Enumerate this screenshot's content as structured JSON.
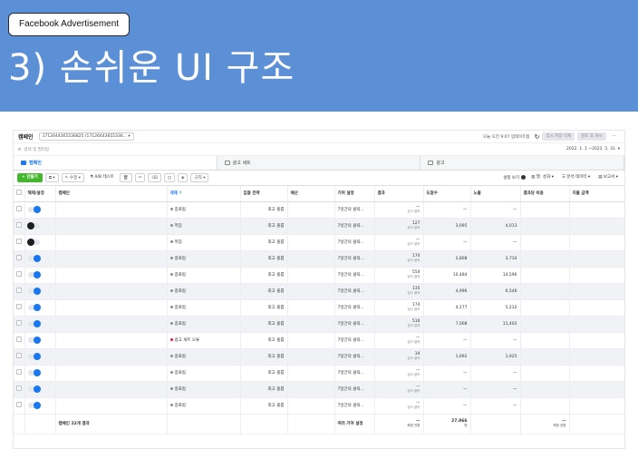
{
  "banner": {
    "tag": "Facebook Advertisement",
    "headline": "3) 손쉬운 UI 구조"
  },
  "header": {
    "title": "캠페인",
    "account": "1712644365536825 (17126443655336...",
    "updated": "오늘 오전 9:07 업데이트됨",
    "discard": "임시 저장 삭제",
    "review": "검토 후 게시",
    "more": "···"
  },
  "search": {
    "placeholder": "검색 및 필터링",
    "date_range": "2022. 1. 1.~2022. 5. 31."
  },
  "tabs": [
    "캠페인",
    "광고 세트",
    "광고"
  ],
  "toolbar": {
    "create": "+ 만들기",
    "edit": "수정",
    "ab_test": "A/B 테스트",
    "rules": "규칙",
    "setting_view": "설정 보기",
    "columns": "열: 성과",
    "breakdown": "분석 데이터",
    "reports": "보고서"
  },
  "columns": [
    "",
    "해제/설정",
    "캠페인",
    "게재 ↑",
    "입찰 전략",
    "예산",
    "기여 설정",
    "결과",
    "도달수",
    "노출",
    "결과당 비용",
    "지출 금액"
  ],
  "rows": [
    {
      "on": true,
      "status": "종료됨",
      "err": false,
      "bid": "최고 볼륨",
      "attr": "7일간의 클릭...",
      "result": "—",
      "result_sub": "링크 클릭",
      "reach": "—",
      "impr": "—"
    },
    {
      "on": false,
      "status": "꺼짐",
      "err": false,
      "bid": "최고 볼륨",
      "attr": "7일간의 클릭...",
      "result": "127",
      "result_sub": "링크 클릭",
      "reach": "3,095",
      "impr": "4,013"
    },
    {
      "on": false,
      "status": "꺼짐",
      "err": false,
      "bid": "최고 볼륨",
      "attr": "7일간의 클릭...",
      "result": "—",
      "result_sub": "링크 클릭",
      "reach": "—",
      "impr": "—"
    },
    {
      "on": true,
      "status": "종료됨",
      "err": false,
      "bid": "최고 볼륨",
      "attr": "7일간의 클릭...",
      "result": "174",
      "result_sub": "링크 클릭",
      "reach": "2,808",
      "impr": "3,734"
    },
    {
      "on": true,
      "status": "종료됨",
      "err": false,
      "bid": "최고 볼륨",
      "attr": "7일간의 클릭...",
      "result": "554",
      "result_sub": "링크 클릭",
      "reach": "10,484",
      "impr": "14,596"
    },
    {
      "on": true,
      "status": "종료됨",
      "err": false,
      "bid": "최고 볼륨",
      "attr": "7일간의 클릭...",
      "result": "135",
      "result_sub": "링크 클릭",
      "reach": "4,996",
      "impr": "6,546"
    },
    {
      "on": true,
      "status": "종료됨",
      "err": false,
      "bid": "최고 볼륨",
      "attr": "7일간의 클릭...",
      "result": "174",
      "result_sub": "링크 클릭",
      "reach": "4,177",
      "impr": "5,232"
    },
    {
      "on": true,
      "status": "종료됨",
      "err": false,
      "bid": "최고 볼륨",
      "attr": "7일간의 클릭...",
      "result": "516",
      "result_sub": "링크 클릭",
      "reach": "7,008",
      "impr": "11,402"
    },
    {
      "on": true,
      "status": "광고 세트 오류",
      "err": true,
      "bid": "최고 볼륨",
      "attr": "7일간의 클릭...",
      "result": "—",
      "result_sub": "링크 클릭",
      "reach": "—",
      "impr": "—"
    },
    {
      "on": true,
      "status": "종료됨",
      "err": false,
      "bid": "최고 볼륨",
      "attr": "7일간의 클릭...",
      "result": "34",
      "result_sub": "링크 클릭",
      "reach": "1,692",
      "impr": "1,925"
    },
    {
      "on": true,
      "status": "종료됨",
      "err": false,
      "bid": "최고 볼륨",
      "attr": "7일간의 클릭...",
      "result": "—",
      "result_sub": "링크 클릭",
      "reach": "—",
      "impr": "—"
    },
    {
      "on": true,
      "status": "종료됨",
      "err": false,
      "bid": "최고 볼륨",
      "attr": "7일간의 클릭...",
      "result": "—",
      "result_sub": "링크 클릭",
      "reach": "—",
      "impr": "—"
    },
    {
      "on": true,
      "status": "종료됨",
      "err": false,
      "bid": "최고 볼륨",
      "attr": "7일간의 클릭...",
      "result": "—",
      "result_sub": "링크 클릭",
      "reach": "—",
      "impr": "—"
    }
  ],
  "footer": {
    "label": "캠페인 22개 결과",
    "attr": "여러 기여 설정",
    "result": "—",
    "result_sub": "복합 전환",
    "reach": "27,866",
    "reach_sub": "명",
    "cpr": "—",
    "cpr_sub": "복합 전환"
  }
}
